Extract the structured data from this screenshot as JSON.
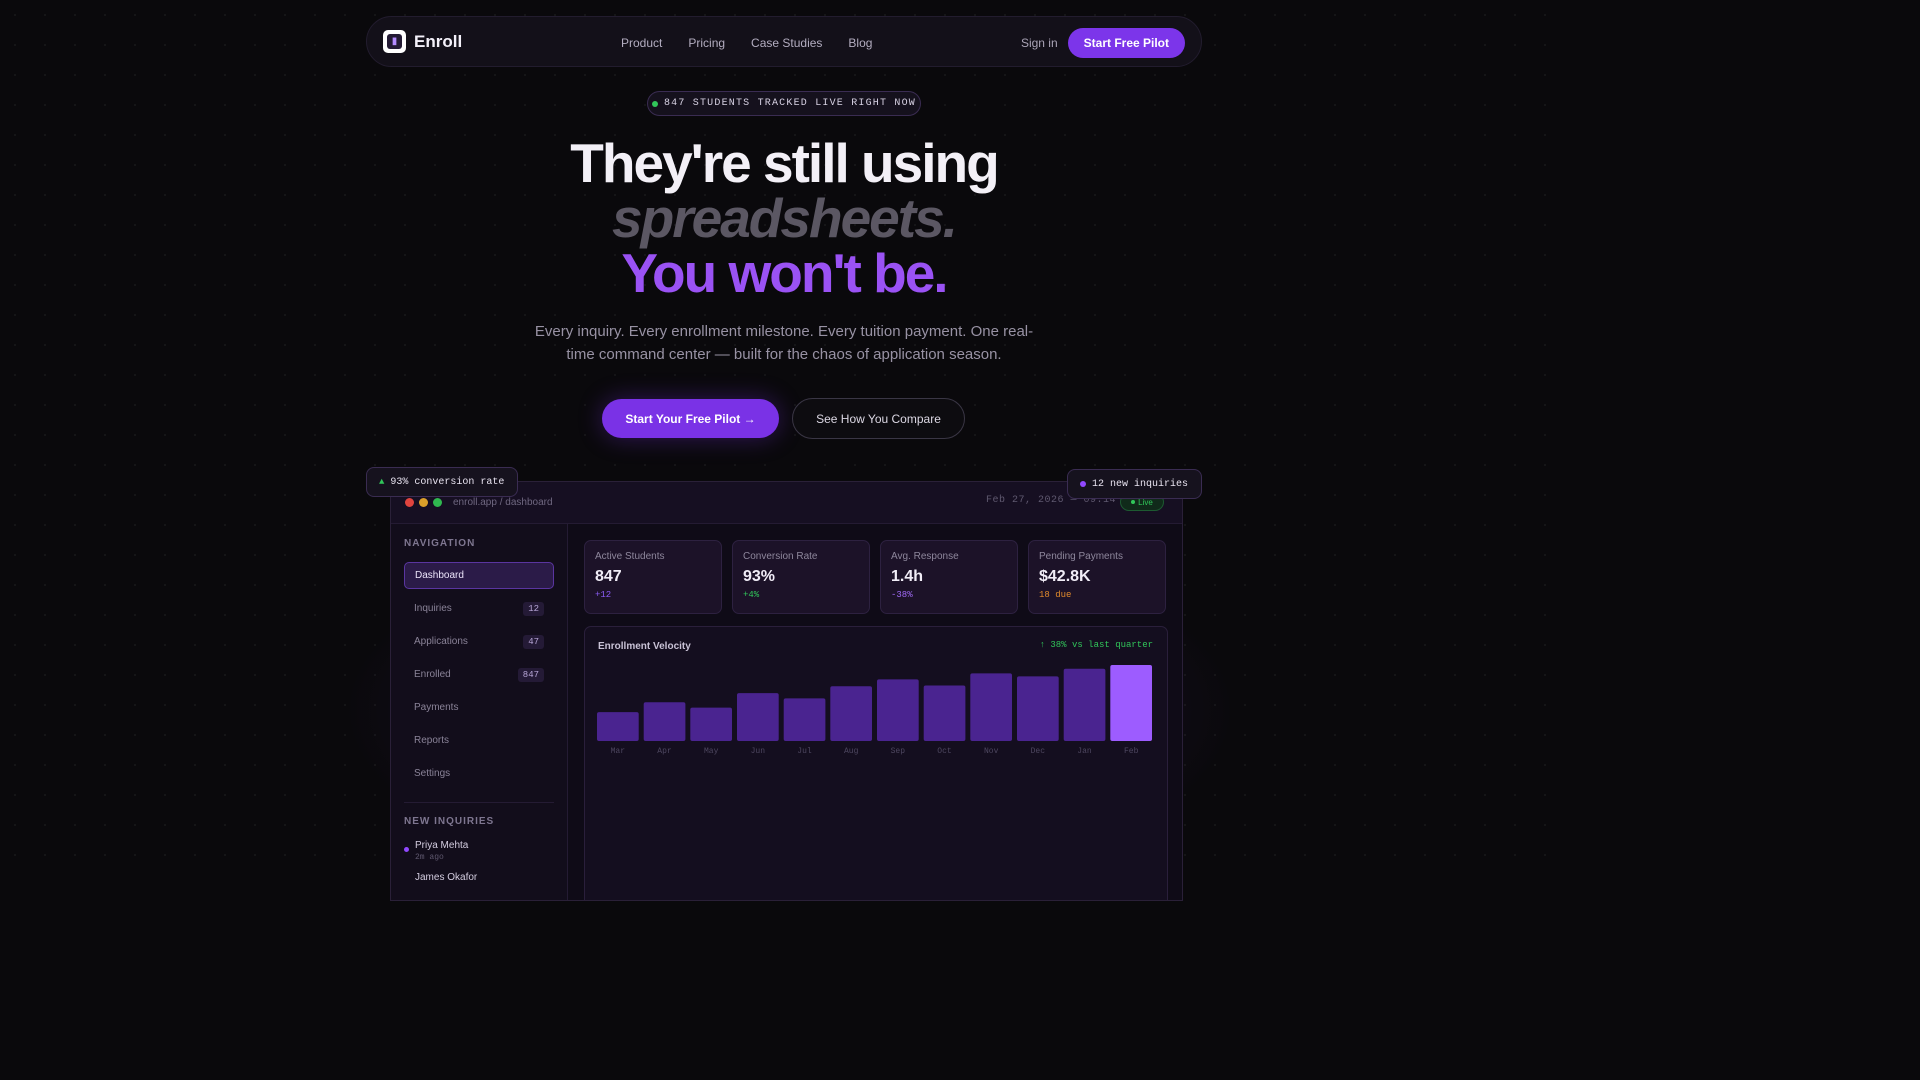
{
  "nav": {
    "brand": "Enroll",
    "logo_icon": "enroll-logo-icon",
    "links": [
      "Product",
      "Pricing",
      "Case Studies",
      "Blog"
    ],
    "signin": "Sign in",
    "cta": "Start Free Pilot"
  },
  "hero": {
    "badge": "847 STUDENTS TRACKED LIVE RIGHT NOW",
    "line1": "They're still using",
    "line2": "spreadsheets.",
    "line3": "You won't be.",
    "subtitle": "Every inquiry. Every enrollment milestone. Every tuition payment. One real-time command center — built for the chaos of application season.",
    "primary_cta": "Start Your Free Pilot →",
    "secondary_cta": "See How You Compare"
  },
  "floats": {
    "left": "93% conversion rate",
    "right": "12 new inquiries"
  },
  "dashboard": {
    "url": "enroll.app / dashboard",
    "date": "Feb 27, 2026 — 09:14",
    "live": "Live",
    "sidebar": {
      "heading": "NAVIGATION",
      "items": [
        {
          "label": "Dashboard",
          "count": ""
        },
        {
          "label": "Inquiries",
          "count": "12"
        },
        {
          "label": "Applications",
          "count": "47"
        },
        {
          "label": "Enrolled",
          "count": "847"
        },
        {
          "label": "Payments",
          "count": ""
        },
        {
          "label": "Reports",
          "count": ""
        },
        {
          "label": "Settings",
          "count": ""
        }
      ],
      "inquiries_heading": "NEW INQUIRIES",
      "inquiries": [
        {
          "name": "Priya Mehta",
          "time": "2m ago"
        },
        {
          "name": "James Okafor",
          "time": ""
        }
      ]
    },
    "stats": [
      {
        "label": "Active Students",
        "value": "847",
        "delta": "+12",
        "delta_color": "#8b5cf6"
      },
      {
        "label": "Conversion Rate",
        "value": "93%",
        "delta": "+4%",
        "delta_color": "#31c65a"
      },
      {
        "label": "Avg. Response",
        "value": "1.4h",
        "delta": "-38%",
        "delta_color": "#a06af6"
      },
      {
        "label": "Pending Payments",
        "value": "$42.8K",
        "delta": "18 due",
        "delta_color": "#e08a2c"
      }
    ],
    "chart_title": "Enrollment Velocity",
    "chart_delta": "↑ 38% vs last quarter"
  },
  "colors": {
    "accent": "#7c35ea",
    "bar": "#4a2490",
    "bar_highlight": "#9d5cff",
    "green": "#31c65a"
  },
  "chart_data": {
    "type": "bar",
    "title": "Enrollment Velocity",
    "categories": [
      "Mar",
      "Apr",
      "May",
      "Jun",
      "Jul",
      "Aug",
      "Sep",
      "Oct",
      "Nov",
      "Dec",
      "Jan",
      "Feb"
    ],
    "values": [
      38,
      51,
      44,
      63,
      56,
      72,
      81,
      73,
      89,
      85,
      95,
      100
    ],
    "ylim": [
      0,
      100
    ],
    "grid": false,
    "highlight_last": true
  }
}
